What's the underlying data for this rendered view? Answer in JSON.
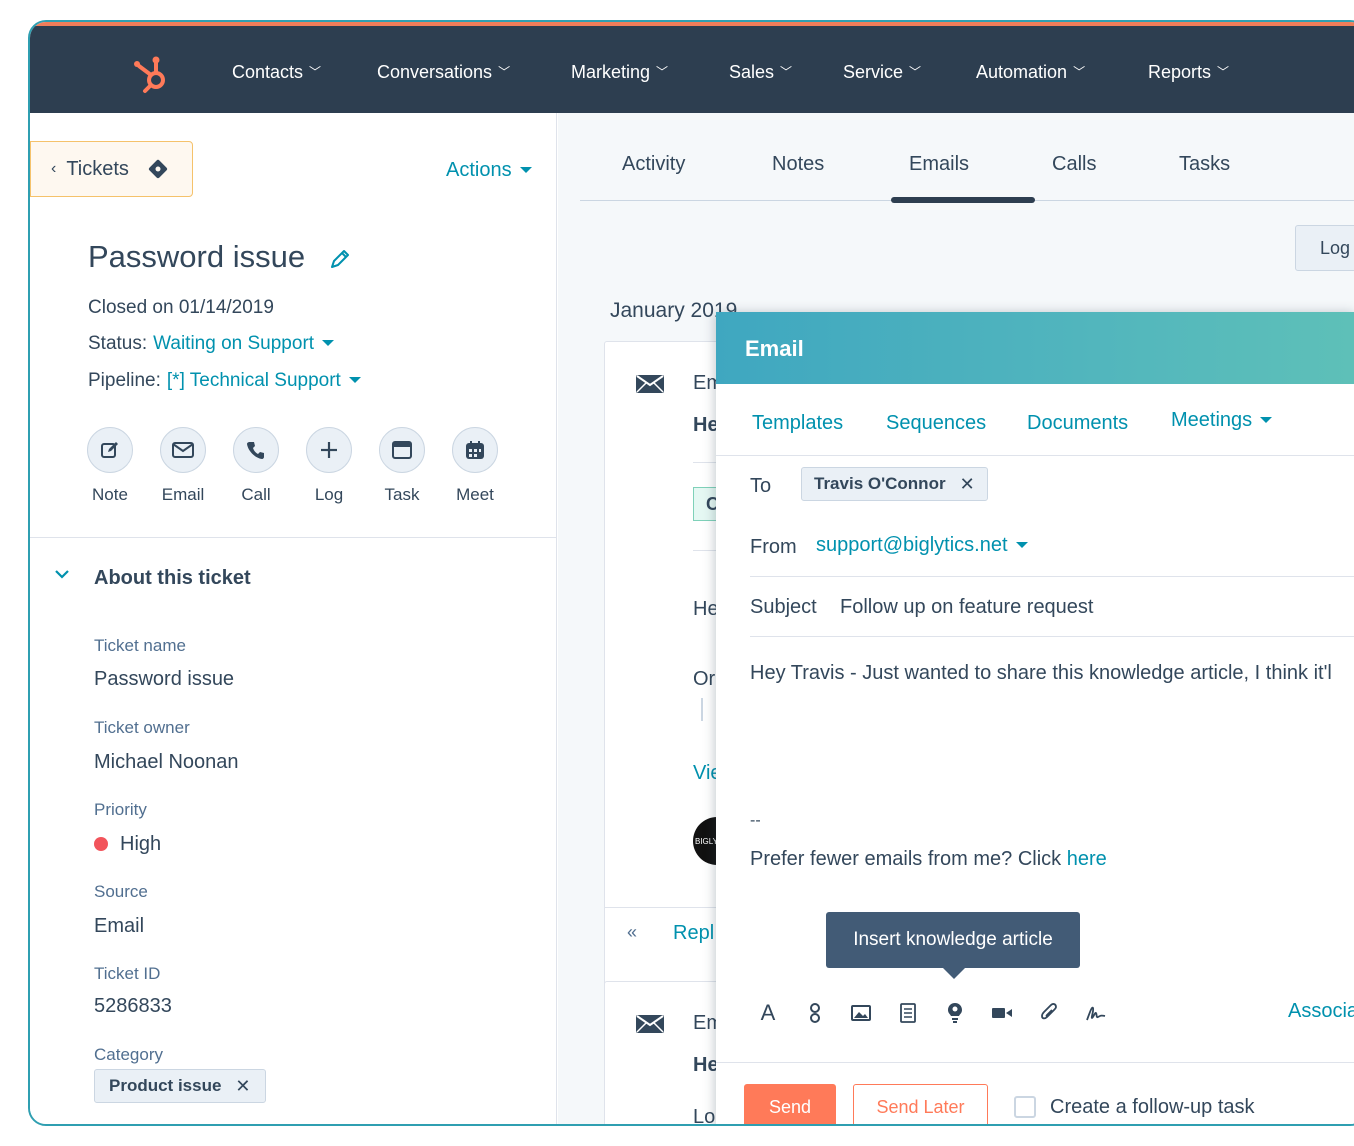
{
  "nav": {
    "items": [
      "Contacts",
      "Conversations",
      "Marketing",
      "Sales",
      "Service",
      "Automation",
      "Reports"
    ],
    "colors": {
      "bg": "#2d3e50",
      "accent": "#ff7a59"
    }
  },
  "left": {
    "back_label": "Tickets",
    "actions_label": "Actions",
    "title": "Password issue",
    "closed_on": "Closed on 01/14/2019",
    "status_label": "Status:",
    "status_value": "Waiting on Support",
    "pipeline_label": "Pipeline:",
    "pipeline_value": "[*] Technical Support",
    "quick_actions": [
      "Note",
      "Email",
      "Call",
      "Log",
      "Task",
      "Meet"
    ],
    "about_title": "About this ticket",
    "properties": {
      "ticket_name_label": "Ticket name",
      "ticket_name_value": "Password issue",
      "owner_label": "Ticket owner",
      "owner_value": "Michael Noonan",
      "priority_label": "Priority",
      "priority_value": "High",
      "source_label": "Source",
      "source_value": "Email",
      "id_label": "Ticket ID",
      "id_value": "5286833",
      "category_label": "Category",
      "category_value": "Product issue"
    }
  },
  "right": {
    "tabs": [
      "Activity",
      "Notes",
      "Emails",
      "Calls",
      "Tasks"
    ],
    "active_tab": "Emails",
    "log_button": "Log",
    "month": "January 2019",
    "card1": {
      "line1": "Em",
      "line2": "He",
      "chip": "C",
      "line3": "He",
      "line4": "Or",
      "quote": "I",
      "view": "Vie",
      "avatar_text": "BIGLY",
      "reply": "Repl"
    },
    "card2": {
      "line1": "Em",
      "line2": "He",
      "line3": "Lo"
    }
  },
  "composer": {
    "title": "Email",
    "tabs": [
      "Templates",
      "Sequences",
      "Documents",
      "Meetings"
    ],
    "to_label": "To",
    "to_value": "Travis O'Connor",
    "from_label": "From",
    "from_value": "support@biglytics.net",
    "subject_label": "Subject",
    "subject_value": "Follow up on feature request",
    "body": "Hey Travis - Just wanted to share this knowledge article, I think it'l",
    "signature_dash": "--",
    "signature_text": "Prefer fewer emails from me? Click ",
    "signature_link": "here",
    "tooltip": "Insert knowledge article",
    "text_tool": "A",
    "associate_label": "Associa",
    "send_label": "Send",
    "send_later_label": "Send Later",
    "followup_label": "Create a follow-up task"
  }
}
